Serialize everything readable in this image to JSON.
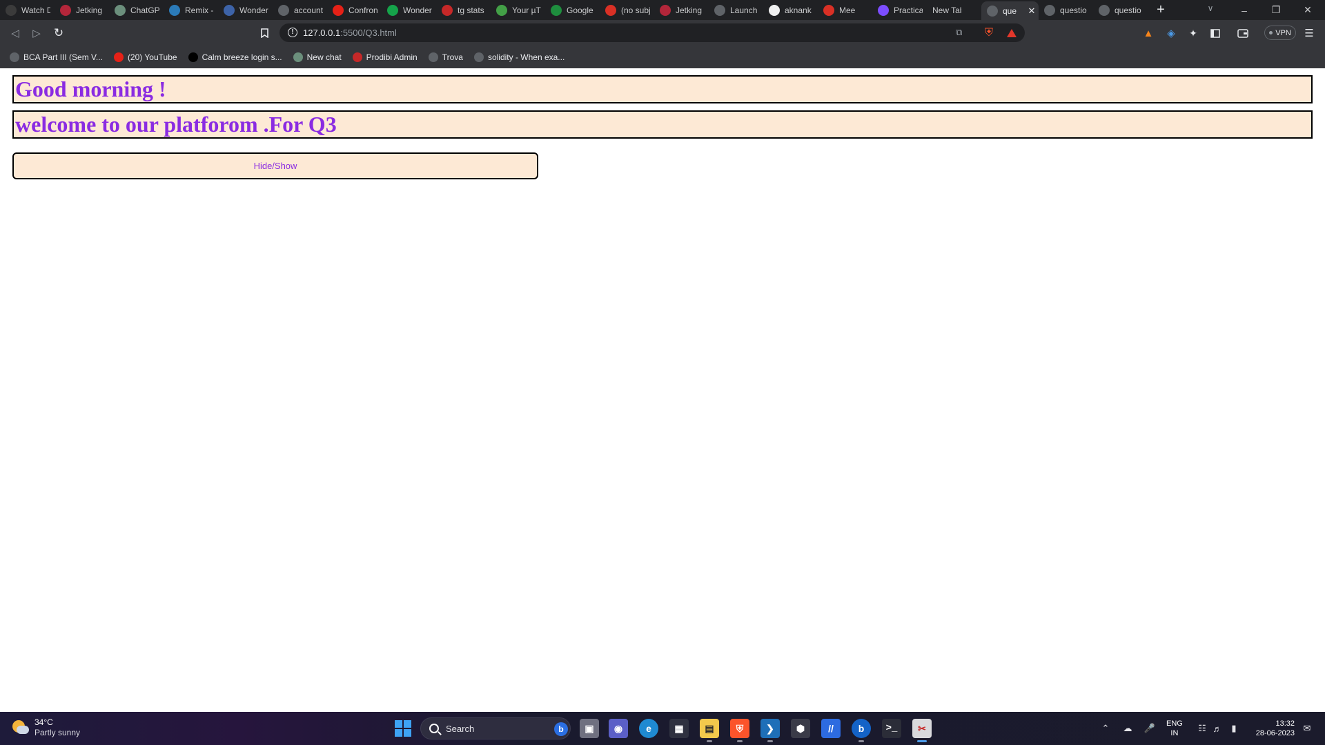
{
  "tabs": [
    {
      "title": "Watch D",
      "icon": "watch-icon",
      "color": "#3b3b3b"
    },
    {
      "title": "Jetking",
      "icon": "jetking-shield-icon",
      "color": "#b3263a"
    },
    {
      "title": "ChatGPT",
      "icon": "chatgpt-icon",
      "color": "#6b8f7c"
    },
    {
      "title": "Remix -",
      "icon": "remix-icon",
      "color": "#2b7bb9"
    },
    {
      "title": "Wonder",
      "icon": "wonder-icon",
      "color": "#3d63a8"
    },
    {
      "title": "account",
      "icon": "globe-icon",
      "color": "#5f6368"
    },
    {
      "title": "Confron",
      "icon": "youtube-icon",
      "color": "#e62117"
    },
    {
      "title": "Wonder",
      "icon": "grammarly-icon",
      "color": "#15a34a"
    },
    {
      "title": "tg stats",
      "icon": "tgstats-icon",
      "color": "#c62828"
    },
    {
      "title": "Your µT",
      "icon": "utorrent-icon",
      "color": "#43a047"
    },
    {
      "title": "Google",
      "icon": "google-drive-icon",
      "color": "#1e8e3e"
    },
    {
      "title": "(no subj",
      "icon": "gmail-icon",
      "color": "#d93025"
    },
    {
      "title": "Jetking",
      "icon": "jetking-shield-icon",
      "color": "#b3263a"
    },
    {
      "title": "Launch",
      "icon": "globe-icon",
      "color": "#5f6368"
    },
    {
      "title": "aknank",
      "icon": "github-icon",
      "color": "#f0f0f0"
    },
    {
      "title": "Mee",
      "icon": "meet-icon",
      "color": "#d93025"
    },
    {
      "title": "Practica",
      "icon": "docs-icon",
      "color": "#7c4dff"
    },
    {
      "title": "New Tab",
      "icon": "",
      "color": ""
    },
    {
      "title": "que",
      "icon": "globe-icon",
      "color": "#5f6368",
      "active": true
    },
    {
      "title": "questio",
      "icon": "globe-icon",
      "color": "#5f6368"
    },
    {
      "title": "questio",
      "icon": "globe-icon",
      "color": "#5f6368"
    }
  ],
  "toolbar": {
    "url_host": "127.0.0.1",
    "url_rest": ":5500/Q3.html",
    "vpn_label": "VPN"
  },
  "bookmarks": [
    {
      "label": "BCA Part III (Sem V...",
      "icon": "globe-icon",
      "color": "#5f6368"
    },
    {
      "label": "(20) YouTube",
      "icon": "youtube-icon",
      "color": "#e62117"
    },
    {
      "label": "Calm breeze login s...",
      "icon": "codepen-icon",
      "color": "#000000"
    },
    {
      "label": "New chat",
      "icon": "chatgpt-icon",
      "color": "#6b8f7c"
    },
    {
      "label": "Prodibi Admin",
      "icon": "prodibi-icon",
      "color": "#c62828"
    },
    {
      "label": "Trova",
      "icon": "globe-icon",
      "color": "#5f6368"
    },
    {
      "label": "solidity - When exa...",
      "icon": "solidity-icon",
      "color": "#5f6368"
    }
  ],
  "page": {
    "heading1": "Good morning !",
    "heading2": "welcome to our platforom .For Q3",
    "button_label": "Hide/Show",
    "accent_color": "#8a2be2",
    "box_background": "#fde9d5"
  },
  "taskbar": {
    "weather_temp": "34°C",
    "weather_desc": "Partly sunny",
    "search_label": "Search",
    "lang_line1": "ENG",
    "lang_line2": "IN",
    "time": "13:32",
    "date": "28-06-2023"
  }
}
